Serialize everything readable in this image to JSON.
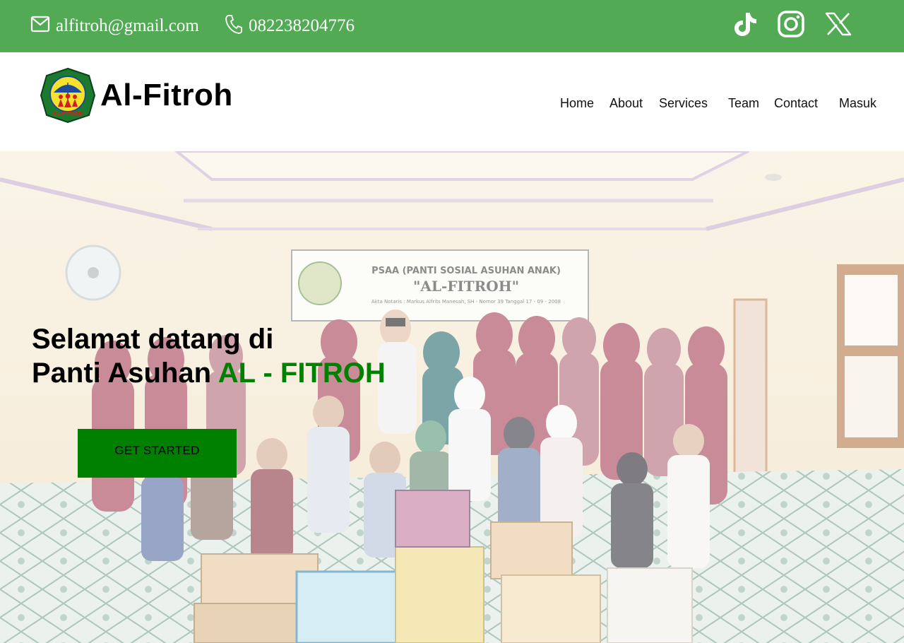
{
  "topbar": {
    "email": "alfitroh@gmail.com",
    "phone": "082238204776",
    "background_color": "#52aa55",
    "icons": {
      "email": "envelope-icon",
      "phone": "phone-icon",
      "socials": [
        "tiktok-icon",
        "instagram-icon",
        "x-icon"
      ]
    }
  },
  "header": {
    "brand_name": "Al-Fitroh",
    "logo_text": "AL-FITROH",
    "nav": {
      "home": "Home",
      "about": "About",
      "services": "Services",
      "team": "Team",
      "contact": "Contact",
      "login": "Masuk"
    }
  },
  "hero": {
    "title_line1": "Selamat datang di",
    "title_line2": "Panti Asuhan ",
    "title_accent": "AL - FITROH",
    "accent_color": "#008000",
    "cta_label": "GET STARTED",
    "banner": {
      "line1": "PSAA (PANTI SOSIAL ASUHAN ANAK)",
      "line2": "\"AL-FITROH\"",
      "line3": "Akta Notaris : Markus Alfrits Manesah, SH - Nomor 39 Tanggal 17 - 09 - 2008"
    }
  }
}
